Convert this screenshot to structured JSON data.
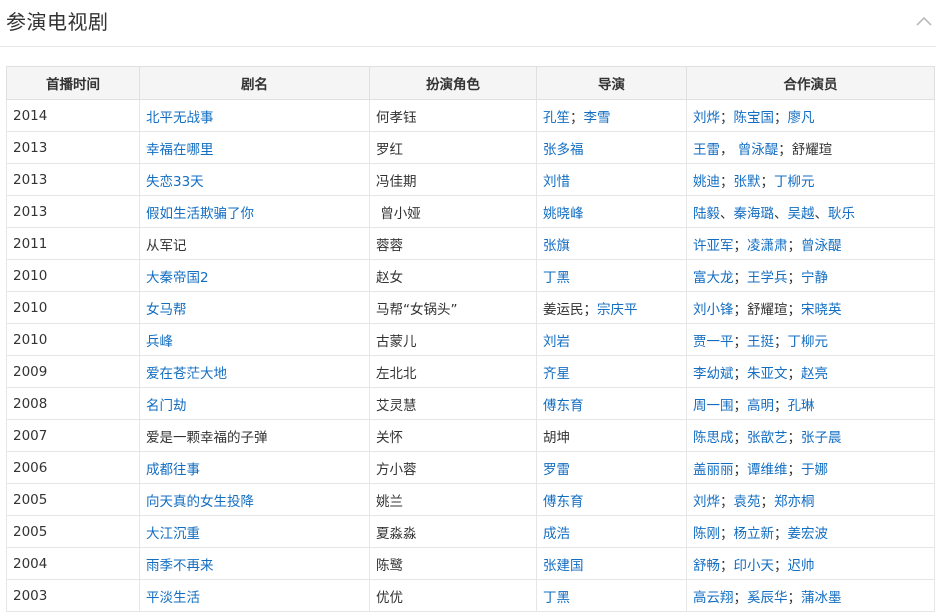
{
  "section": {
    "title": "参演电视剧"
  },
  "table": {
    "headers": [
      "首播时间",
      "剧名",
      "扮演角色",
      "导演",
      "合作演员"
    ],
    "rows": [
      {
        "year": "2014",
        "title": {
          "text": "北平无战事",
          "link": true
        },
        "role": "何孝钰",
        "directors": [
          {
            "text": "孔笙",
            "link": true
          },
          {
            "text": "李雪",
            "link": true
          }
        ],
        "director_sep": "；",
        "costars": [
          {
            "text": "刘烨",
            "link": true
          },
          {
            "text": "陈宝国",
            "link": true
          },
          {
            "text": "廖凡",
            "link": true
          }
        ],
        "costar_seps": [
          "；",
          "；"
        ]
      },
      {
        "year": "2013",
        "title": {
          "text": "幸福在哪里",
          "link": true
        },
        "role": "罗红",
        "directors": [
          {
            "text": "张多福",
            "link": true
          }
        ],
        "director_sep": "",
        "costars": [
          {
            "text": "王雷",
            "link": true
          },
          {
            "text": "曾泳醍",
            "link": true
          },
          {
            "text": "舒耀瑄",
            "link": false
          }
        ],
        "costar_seps": [
          "， ",
          "；"
        ]
      },
      {
        "year": "2013",
        "title": {
          "text": "失恋33天",
          "link": true
        },
        "role": "冯佳期",
        "directors": [
          {
            "text": "刘惜",
            "link": true
          }
        ],
        "director_sep": "",
        "costars": [
          {
            "text": "姚迪",
            "link": true
          },
          {
            "text": "张默",
            "link": true
          },
          {
            "text": "丁柳元",
            "link": true
          }
        ],
        "costar_seps": [
          "；",
          "；"
        ]
      },
      {
        "year": "2013",
        "title": {
          "text": "假如生活欺骗了你",
          "link": true
        },
        "role": " 曾小娅",
        "directors": [
          {
            "text": "姚晓峰",
            "link": true
          }
        ],
        "director_sep": "",
        "costars": [
          {
            "text": "陆毅",
            "link": true
          },
          {
            "text": "秦海璐",
            "link": true
          },
          {
            "text": "吴越",
            "link": true
          },
          {
            "text": "耿乐",
            "link": true
          }
        ],
        "costar_seps": [
          "、",
          "、",
          "、"
        ]
      },
      {
        "year": "2011",
        "title": {
          "text": "从军记",
          "link": false
        },
        "role": "蓉蓉",
        "directors": [
          {
            "text": "张旗",
            "link": true
          }
        ],
        "director_sep": "",
        "costars": [
          {
            "text": "许亚军",
            "link": true
          },
          {
            "text": "凌潇肃",
            "link": true
          },
          {
            "text": "曾泳醍",
            "link": true
          }
        ],
        "costar_seps": [
          "；",
          "；"
        ]
      },
      {
        "year": "2010",
        "title": {
          "text": "大秦帝国2",
          "link": true
        },
        "role": "赵女",
        "directors": [
          {
            "text": "丁黑",
            "link": true
          }
        ],
        "director_sep": "",
        "costars": [
          {
            "text": "富大龙",
            "link": true
          },
          {
            "text": "王学兵",
            "link": true
          },
          {
            "text": "宁静",
            "link": true
          }
        ],
        "costar_seps": [
          "；",
          "；"
        ]
      },
      {
        "year": "2010",
        "title": {
          "text": "女马帮",
          "link": true
        },
        "role": "马帮“女锅头”",
        "directors": [
          {
            "text": "姜运民",
            "link": false
          },
          {
            "text": "宗庆平",
            "link": true
          }
        ],
        "director_sep": "；",
        "costars": [
          {
            "text": "刘小锋",
            "link": true
          },
          {
            "text": "舒耀瑄",
            "link": false
          },
          {
            "text": "宋晓英",
            "link": true
          }
        ],
        "costar_seps": [
          "；",
          "；"
        ]
      },
      {
        "year": "2010",
        "title": {
          "text": "兵峰",
          "link": true
        },
        "role": "古蒙儿",
        "directors": [
          {
            "text": "刘岩",
            "link": true
          }
        ],
        "director_sep": "",
        "costars": [
          {
            "text": "贾一平",
            "link": true
          },
          {
            "text": "王挺",
            "link": true
          },
          {
            "text": "丁柳元",
            "link": true
          }
        ],
        "costar_seps": [
          "；",
          "；"
        ]
      },
      {
        "year": "2009",
        "title": {
          "text": "爱在苍茫大地",
          "link": true
        },
        "role": "左北北",
        "directors": [
          {
            "text": "齐星",
            "link": true
          }
        ],
        "director_sep": "",
        "costars": [
          {
            "text": "李幼斌",
            "link": true
          },
          {
            "text": "朱亚文",
            "link": true
          },
          {
            "text": "赵亮",
            "link": true
          }
        ],
        "costar_seps": [
          "；",
          "；"
        ]
      },
      {
        "year": "2008",
        "title": {
          "text": "名门劫",
          "link": true
        },
        "role": "艾灵慧",
        "directors": [
          {
            "text": "傅东育",
            "link": true
          }
        ],
        "director_sep": "",
        "costars": [
          {
            "text": "周一围",
            "link": true
          },
          {
            "text": "高明",
            "link": true
          },
          {
            "text": "孔琳",
            "link": true
          }
        ],
        "costar_seps": [
          "；",
          "；"
        ]
      },
      {
        "year": "2007",
        "title": {
          "text": "爱是一颗幸福的子弹",
          "link": false
        },
        "role": "关怀",
        "directors": [
          {
            "text": "胡坤",
            "link": false
          }
        ],
        "director_sep": "",
        "costars": [
          {
            "text": "陈思成",
            "link": true
          },
          {
            "text": "张歆艺",
            "link": true
          },
          {
            "text": "张子晨",
            "link": true
          }
        ],
        "costar_seps": [
          "；",
          "；"
        ]
      },
      {
        "year": "2006",
        "title": {
          "text": "成都往事",
          "link": true
        },
        "role": "方小蓉",
        "directors": [
          {
            "text": "罗雷",
            "link": true
          }
        ],
        "director_sep": "",
        "costars": [
          {
            "text": "盖丽丽",
            "link": true
          },
          {
            "text": "谭维维",
            "link": true
          },
          {
            "text": "于娜",
            "link": true
          }
        ],
        "costar_seps": [
          "；",
          "；"
        ]
      },
      {
        "year": "2005",
        "title": {
          "text": "向天真的女生投降",
          "link": true
        },
        "role": "姚兰",
        "directors": [
          {
            "text": "傅东育",
            "link": true
          }
        ],
        "director_sep": "",
        "costars": [
          {
            "text": "刘烨",
            "link": true
          },
          {
            "text": "袁苑",
            "link": true
          },
          {
            "text": "郑亦桐",
            "link": true
          }
        ],
        "costar_seps": [
          "；",
          "；"
        ]
      },
      {
        "year": "2005",
        "title": {
          "text": "大江沉重",
          "link": true
        },
        "role": "夏淼淼",
        "directors": [
          {
            "text": "成浩",
            "link": true
          }
        ],
        "director_sep": "",
        "costars": [
          {
            "text": "陈刚",
            "link": true
          },
          {
            "text": "杨立新",
            "link": true
          },
          {
            "text": "姜宏波",
            "link": true
          }
        ],
        "costar_seps": [
          "；",
          "；"
        ]
      },
      {
        "year": "2004",
        "title": {
          "text": "雨季不再来",
          "link": true
        },
        "role": "陈鹭",
        "directors": [
          {
            "text": "张建国",
            "link": true
          }
        ],
        "director_sep": "",
        "costars": [
          {
            "text": "舒畅",
            "link": true
          },
          {
            "text": "印小天",
            "link": true
          },
          {
            "text": "迟帅",
            "link": true
          }
        ],
        "costar_seps": [
          "；",
          "；"
        ]
      },
      {
        "year": "2003",
        "title": {
          "text": "平淡生活",
          "link": true
        },
        "role": "优优",
        "directors": [
          {
            "text": "丁黑",
            "link": true
          }
        ],
        "director_sep": "",
        "costars": [
          {
            "text": "高云翔",
            "link": true
          },
          {
            "text": "奚辰华",
            "link": true
          },
          {
            "text": "蒲冰墨",
            "link": true
          }
        ],
        "costar_seps": [
          "；",
          "；"
        ]
      }
    ]
  },
  "colors": {
    "link": "#136ec2",
    "text": "#333333",
    "header_bg": "#f5f5f5",
    "border": "#e0e0e0"
  },
  "icons": {
    "collapse": "chevron-up-icon"
  }
}
